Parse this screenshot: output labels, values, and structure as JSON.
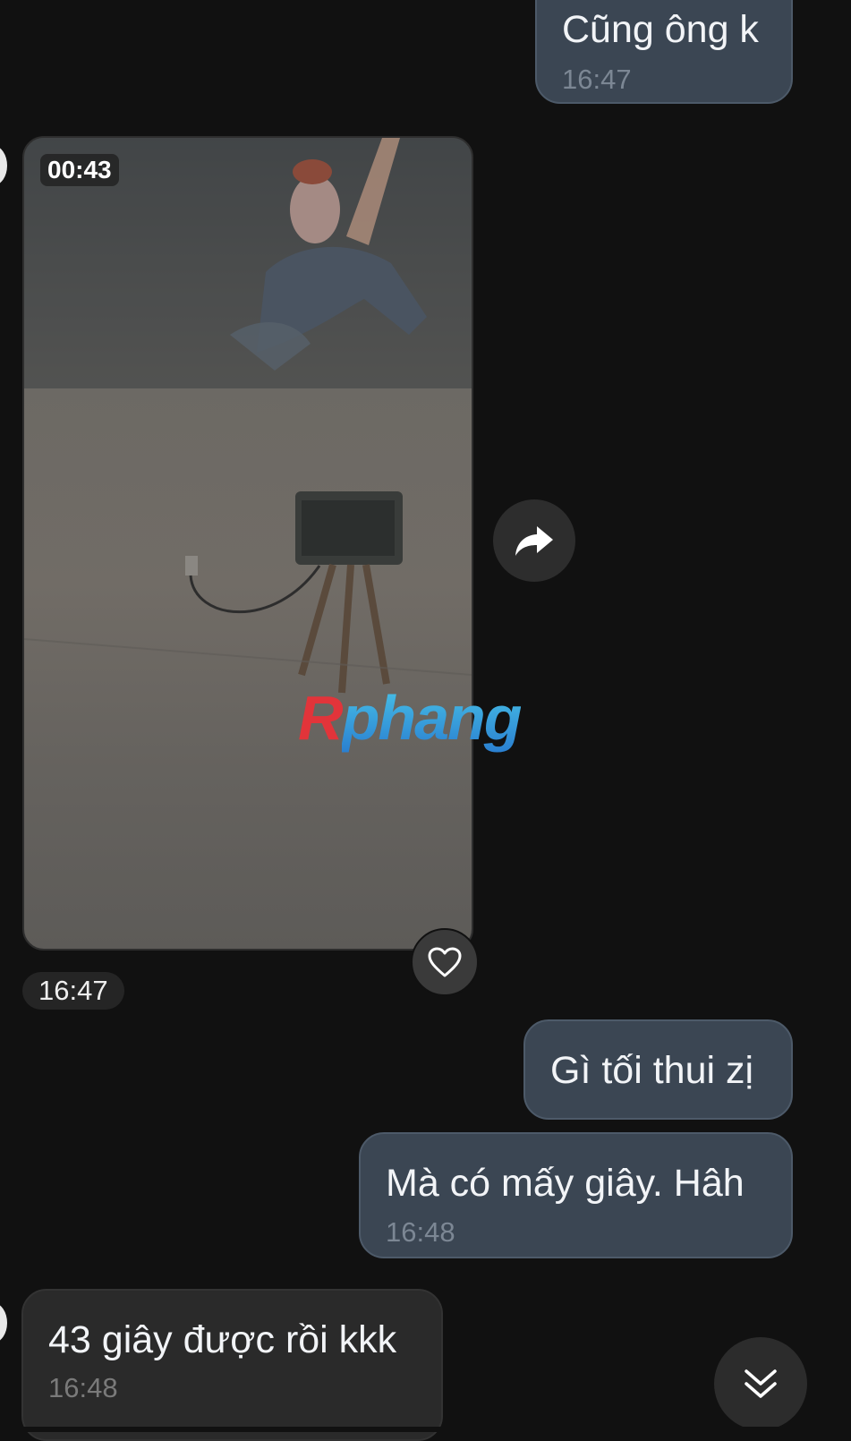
{
  "messages": [
    {
      "id": "m1",
      "direction": "outgoing",
      "text": "Cũng ông k",
      "time": "16:47"
    },
    {
      "id": "m2",
      "direction": "incoming",
      "type": "video",
      "duration": "00:43",
      "time": "16:47"
    },
    {
      "id": "m3",
      "direction": "outgoing",
      "text": "Gì tối thui zị",
      "time": ""
    },
    {
      "id": "m4",
      "direction": "outgoing",
      "text": "Mà có mấy giây. Hâh",
      "time": "16:48"
    },
    {
      "id": "m5",
      "direction": "incoming",
      "text": "43 giây được rồi kkk",
      "time": "16:48"
    }
  ],
  "watermark": {
    "first": "R",
    "rest": "phang"
  },
  "icons": {
    "forward": "forward-arrow-icon",
    "heart": "heart-outline-icon",
    "scroll_down": "double-chevron-down-icon"
  },
  "colors": {
    "background": "#111111",
    "outgoing_bubble": "#3b4653",
    "incoming_bubble": "#2a2a2a",
    "time_text": "#7c8794"
  }
}
